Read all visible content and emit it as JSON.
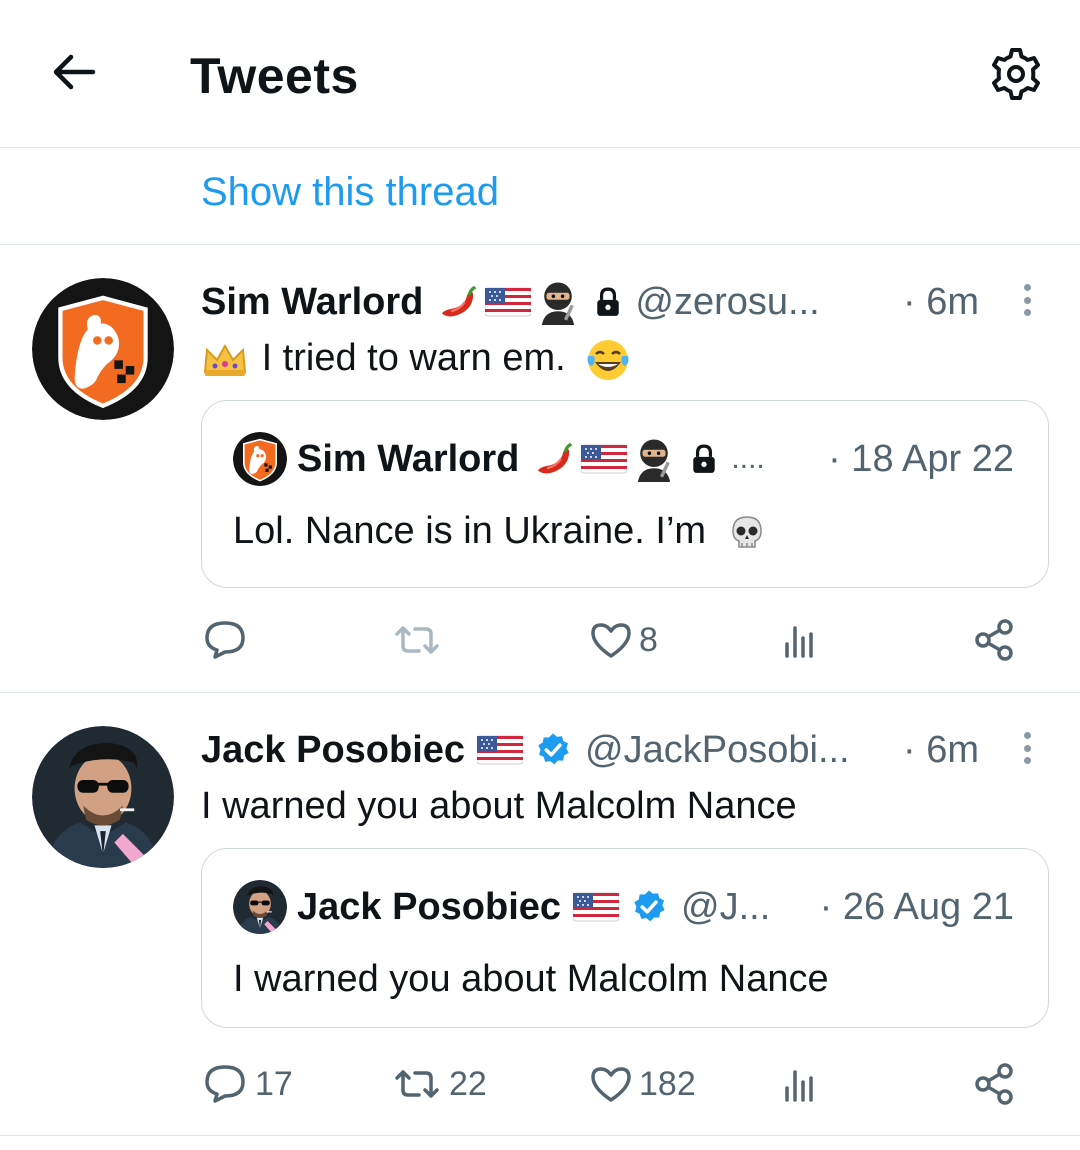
{
  "header": {
    "title": "Tweets",
    "back_icon": "arrow-left-icon",
    "settings_icon": "gear-icon"
  },
  "thread_link": "Show this thread",
  "tweets": [
    {
      "name": "Sim Warlord",
      "name_emojis": [
        "chili-pepper-emoji",
        "us-flag-emoji",
        "ninja-emoji"
      ],
      "protected_icon": "lock-icon",
      "handle": "@zerosu...",
      "time": "· 6m",
      "text": "I tried to warn em.",
      "text_prefix_emoji": "crown-emoji",
      "text_suffix_emoji": "laughing-tears-emoji",
      "quote": {
        "name": "Sim Warlord",
        "name_emojis": [
          "chili-pepper-emoji",
          "us-flag-emoji",
          "ninja-emoji"
        ],
        "protected_icon": "lock-icon",
        "handle": "....",
        "time": "· 18 Apr 22",
        "text": "Lol. Nance is in Ukraine. I’m",
        "text_suffix_emoji": "skull-emoji"
      },
      "actions": {
        "reply": "",
        "retweet": "",
        "like": "8",
        "views": "",
        "share": ""
      }
    },
    {
      "name": "Jack Posobiec",
      "name_emojis": [
        "us-flag-emoji"
      ],
      "verified_icon": "verified-badge-icon",
      "handle": "@JackPosobi...",
      "time": "· 6m",
      "text": "I warned you about Malcolm Nance",
      "quote": {
        "name": "Jack Posobiec",
        "name_emojis": [
          "us-flag-emoji"
        ],
        "verified_icon": "verified-badge-icon",
        "handle": "@J...",
        "time": "· 26 Aug 21",
        "text": "I warned you about Malcolm Nance"
      },
      "actions": {
        "reply": "17",
        "retweet": "22",
        "like": "182",
        "views": "",
        "share": ""
      }
    }
  ],
  "colors": {
    "accent": "#1d9bf0",
    "text_primary": "#0f1419",
    "text_secondary": "#536471",
    "border": "#cfd9de",
    "divider": "#e1e6ea"
  }
}
